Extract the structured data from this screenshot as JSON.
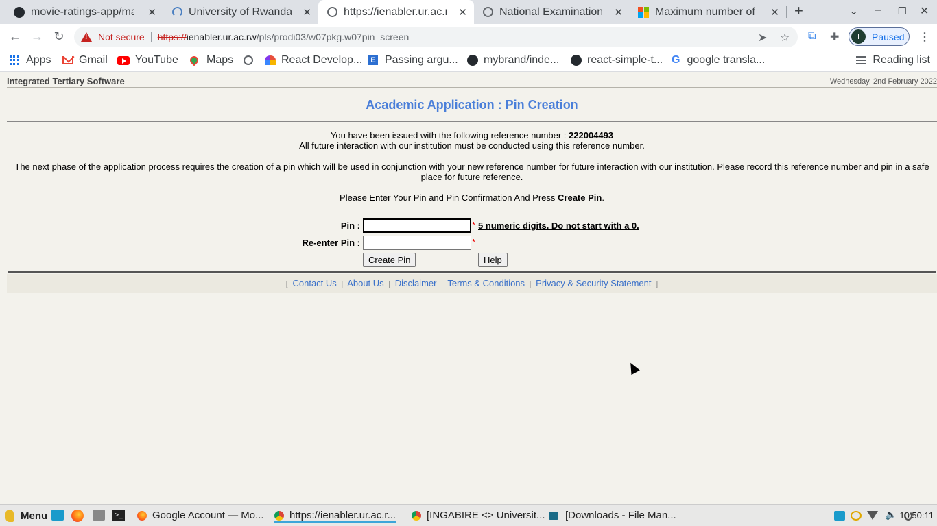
{
  "browser": {
    "tabs": [
      {
        "title": "movie-ratings-app/mai",
        "favicon": "github-icon",
        "active": false
      },
      {
        "title": "University of Rwanda",
        "favicon": "ur-icon",
        "active": false
      },
      {
        "title": "https://ienabler.ur.ac.rw",
        "favicon": "globe-icon",
        "active": true
      },
      {
        "title": "National Examination a",
        "favicon": "globe-icon",
        "active": false
      },
      {
        "title": "Maximum number of c",
        "favicon": "microsoft-icon",
        "active": false
      }
    ],
    "new_tab_label": "+",
    "omnibox": {
      "security_label": "Not secure",
      "url_scheme": "https://",
      "url_host": "ienabler.ur.ac.rw",
      "url_path": "/pls/prodi03/w07pkg.w07pin_screen"
    },
    "profile": {
      "initial": "I",
      "status": "Paused"
    },
    "bookmarks": [
      {
        "label": "Apps",
        "icon": "apps-grid-icon"
      },
      {
        "label": "Gmail",
        "icon": "gmail-icon"
      },
      {
        "label": "YouTube",
        "icon": "youtube-icon"
      },
      {
        "label": "Maps",
        "icon": "maps-icon"
      },
      {
        "label": "",
        "icon": "globe-icon"
      },
      {
        "label": "React Develop...",
        "icon": "react-icon"
      },
      {
        "label": "Passing argu...",
        "icon": "e-icon"
      },
      {
        "label": "mybrand/inde...",
        "icon": "github-icon"
      },
      {
        "label": "react-simple-t...",
        "icon": "github-icon"
      },
      {
        "label": "google transla...",
        "icon": "google-icon"
      }
    ],
    "reading_list": "Reading list"
  },
  "page": {
    "system_name": "Integrated Tertiary Software",
    "date": "Wednesday, 2nd February 2022",
    "title": "Academic Application : Pin Creation",
    "ref_intro": "You have been issued with the following reference number : ",
    "ref_number": "222004493",
    "ref_note": "All future interaction with our institution must be conducted using this reference number.",
    "phase_text": "The next phase of the application process requires the creation of a pin which will be used in conjunction with your new reference number for future interaction with our institution. Please record this reference number and pin in a safe place for future reference.",
    "please_prefix": "Please Enter Your Pin and Pin Confirmation And Press ",
    "please_bold": "Create Pin",
    "please_suffix": ".",
    "form": {
      "pin_label": "Pin :",
      "pin_value": "",
      "reenter_label": "Re-enter Pin :",
      "reenter_value": "",
      "required_mark": "*",
      "pin_hint": "5 numeric digits. Do not start with a 0.",
      "create_button": "Create Pin",
      "help_button": "Help"
    },
    "footer": {
      "open_bracket": "[",
      "close_bracket": "]",
      "separator": "|",
      "links": [
        "Contact Us",
        "About Us",
        "Disclaimer",
        "Terms & Conditions",
        "Privacy & Security Statement"
      ]
    }
  },
  "taskbar": {
    "menu_label": "Menu",
    "windows": [
      {
        "title": "Google Account — Mo...",
        "icon": "firefox-icon"
      },
      {
        "title": "https://ienabler.ur.ac.r...",
        "icon": "chrome-icon",
        "active": true
      },
      {
        "title": "[INGABIRE <> Universit...",
        "icon": "chrome-icon"
      },
      {
        "title": "[Downloads - File Man...",
        "icon": "file-manager-icon"
      }
    ],
    "clock": "10:50:11"
  },
  "colors": {
    "page_background": "#f3f2ec",
    "title_blue": "#4a7fd9",
    "link_blue": "#3b71c9",
    "not_secure_red": "#c5221f"
  }
}
